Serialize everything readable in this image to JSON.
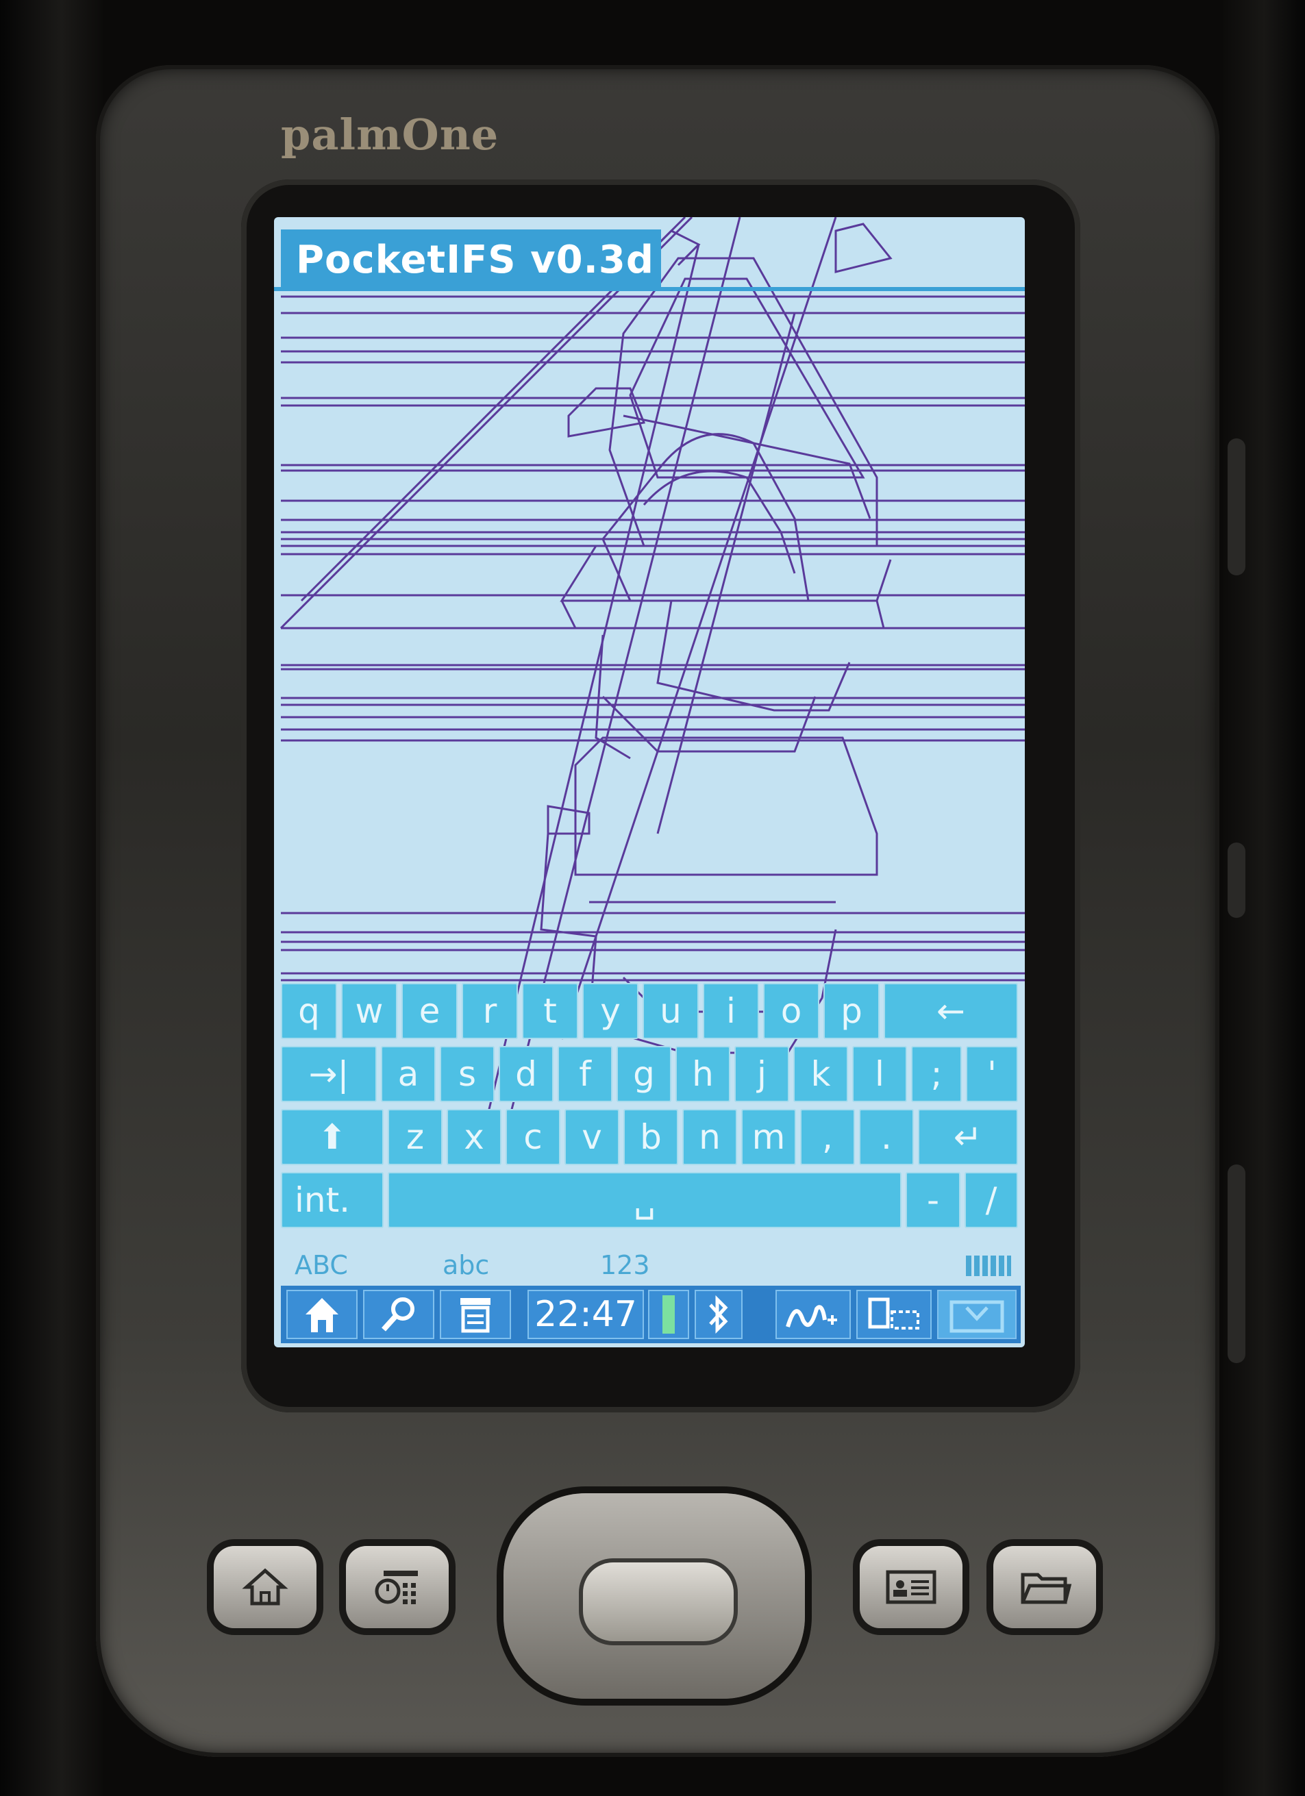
{
  "device": {
    "brand": "palmOne"
  },
  "app": {
    "title": "PocketIFS v0.3d"
  },
  "keyboard": {
    "row1": [
      "q",
      "w",
      "e",
      "r",
      "t",
      "y",
      "u",
      "i",
      "o",
      "p"
    ],
    "row1_backspace": "←",
    "row2_tab": "→|",
    "row2": [
      "a",
      "s",
      "d",
      "f",
      "g",
      "h",
      "j",
      "k",
      "l",
      ";",
      "'"
    ],
    "row3_shift": "⬆",
    "row3": [
      "z",
      "x",
      "c",
      "v",
      "b",
      "n",
      "m",
      ",",
      "."
    ],
    "row3_enter": "↵",
    "row4_int": "int.",
    "row4_space": "␣",
    "row4_keys": [
      "-",
      "/"
    ]
  },
  "input_modes": {
    "upper": "ABC",
    "lower": "abc",
    "numeric": "123"
  },
  "status_bar": {
    "time": "22:47"
  },
  "colors": {
    "screen_bg": "#c4e2f2",
    "accent": "#3aa0d6",
    "key": "#4ec0e4",
    "drawing": "#5a3a9a",
    "status_bar": "#2e7fc8"
  }
}
